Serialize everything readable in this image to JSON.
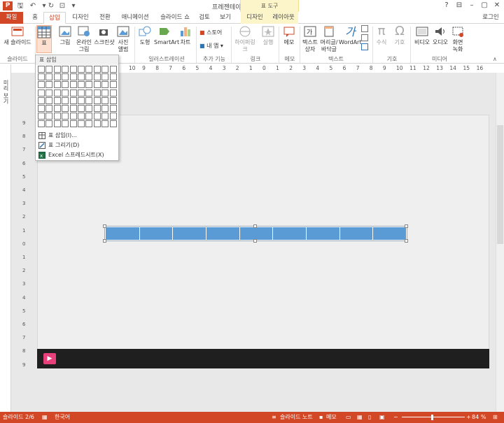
{
  "window": {
    "title": "프레젠테이션1 - PowerPoint",
    "login": "로그인",
    "app_icon": "P",
    "minimize": "–",
    "restore": "▢",
    "close": "✕",
    "help": "?"
  },
  "contextual_header": "표 도구",
  "tabs": [
    {
      "label": "파일"
    },
    {
      "label": "홈"
    },
    {
      "label": "삽입"
    },
    {
      "label": "디자인"
    },
    {
      "label": "전환"
    },
    {
      "label": "애니메이션"
    },
    {
      "label": "슬라이드 쇼"
    },
    {
      "label": "검토"
    },
    {
      "label": "보기"
    },
    {
      "label": "디자인"
    },
    {
      "label": "레이아웃"
    }
  ],
  "ribbon": {
    "new_slide": "새 슬라이드",
    "table": "표",
    "picture": "그림",
    "online_picture_1": "온라인",
    "online_picture_2": "그림",
    "screenshot": "스크린샷",
    "photo_album_1": "사진",
    "photo_album_2": "앨범",
    "shapes": "도형",
    "smartart": "SmartArt",
    "chart": "차트",
    "store": "스토어",
    "my_apps": "내 앱",
    "hyperlink": "하이퍼링크",
    "action": "실행",
    "comment": "메모",
    "textbox_1": "텍스트",
    "textbox_2": "상자",
    "header_footer_1": "머리글/",
    "header_footer_2": "바닥글",
    "wordart": "WordArt",
    "equation": "수식",
    "symbol": "기호",
    "video": "비디오",
    "audio": "오디오",
    "screen_recording_1": "화면",
    "screen_recording_2": "녹화",
    "groups": {
      "slides": "슬라이드",
      "illustrations": "일러스트레이션",
      "addins": "추가 기능",
      "links": "링크",
      "comments": "메모",
      "text": "텍스트",
      "symbols": "기호",
      "media": "미디어"
    }
  },
  "left_pane_label": "미리 보기",
  "dropdown": {
    "header": "표 삽입",
    "insert_table": "표 삽입(I)...",
    "draw_table": "표 그리기(D)",
    "excel_sheet": "Excel 스프레드시트(X)",
    "grid_cols": 10,
    "grid_rows": 8
  },
  "ruler_labels": [
    "10",
    "9",
    "8",
    "7",
    "6",
    "5",
    "4",
    "3",
    "2",
    "1",
    "0",
    "1",
    "2",
    "3",
    "4",
    "5",
    "6",
    "7",
    "8",
    "9",
    "10",
    "11",
    "12",
    "13",
    "14",
    "15",
    "16"
  ],
  "vruler_labels": [
    "9",
    "8",
    "7",
    "6",
    "5",
    "4",
    "3",
    "2",
    "1",
    "0",
    "1",
    "2",
    "3",
    "4",
    "5",
    "6",
    "7",
    "8",
    "9"
  ],
  "table": {
    "columns": 9
  },
  "status": {
    "slide": "슬라이드 2/6",
    "language": "한국어",
    "notes": "슬라이드 노트",
    "comments": "메모",
    "zoom": "84 %"
  },
  "colors": {
    "accent": "#d24726",
    "table_fill": "#5b9bd5",
    "slide_band": "#1f1f1f",
    "play_button": "#e8407a"
  }
}
